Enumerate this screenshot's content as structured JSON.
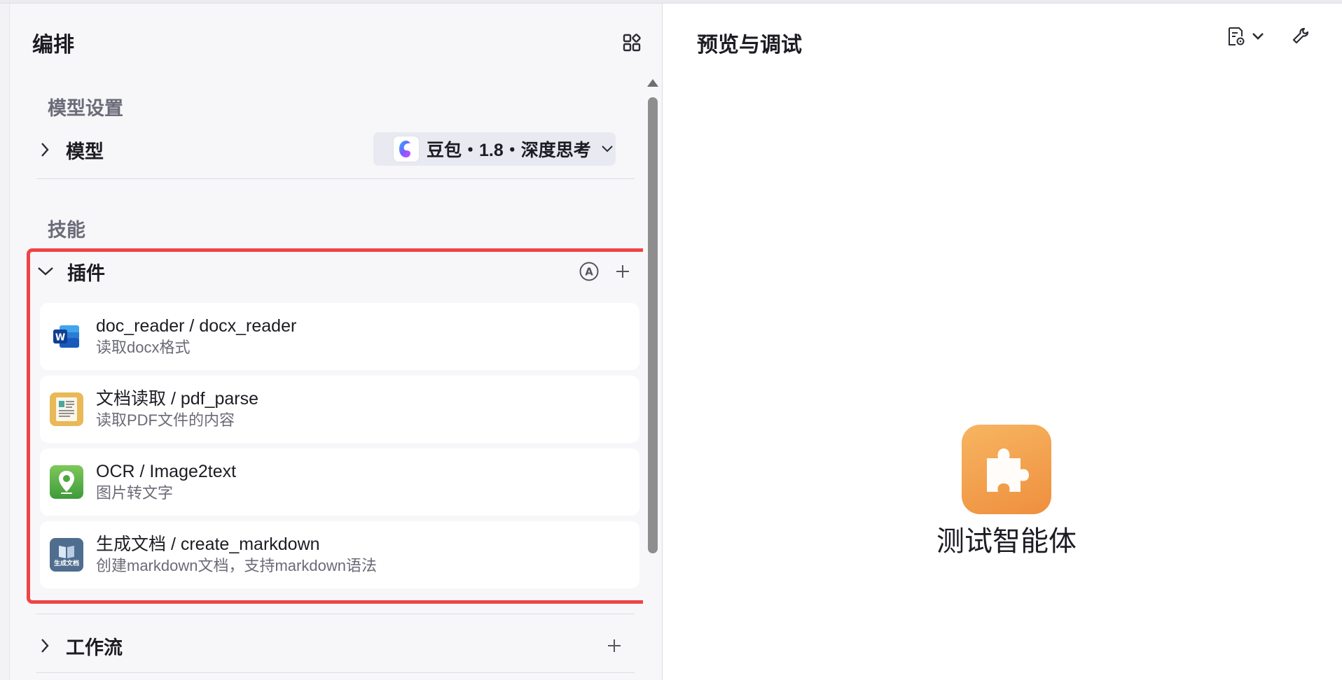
{
  "left_panel": {
    "title": "编排",
    "model_section": {
      "label": "模型设置",
      "row_title": "模型",
      "selected_model": "豆包・1.8・深度思考"
    },
    "skills_section": {
      "label": "技能",
      "plugins": {
        "title": "插件",
        "items": [
          {
            "name": "doc_reader / docx_reader",
            "desc": "读取docx格式",
            "icon": "word-doc-icon"
          },
          {
            "name": "文档读取 / pdf_parse",
            "desc": "读取PDF文件的内容",
            "icon": "document-icon"
          },
          {
            "name": "OCR / Image2text",
            "desc": "图片转文字",
            "icon": "location-pin-icon"
          },
          {
            "name": "生成文档 / create_markdown",
            "desc": "创建markdown文档，支持markdown语法",
            "icon": "book-doc-icon",
            "icon_caption": "生成文档"
          }
        ]
      },
      "workflow": {
        "title": "工作流"
      }
    }
  },
  "right_panel": {
    "title": "预览与调试",
    "agent_name": "测试智能体"
  },
  "colors": {
    "highlight_border": "#ef4444",
    "agent_avatar": "#f0953f",
    "panel_bg": "#f7f7fa"
  }
}
